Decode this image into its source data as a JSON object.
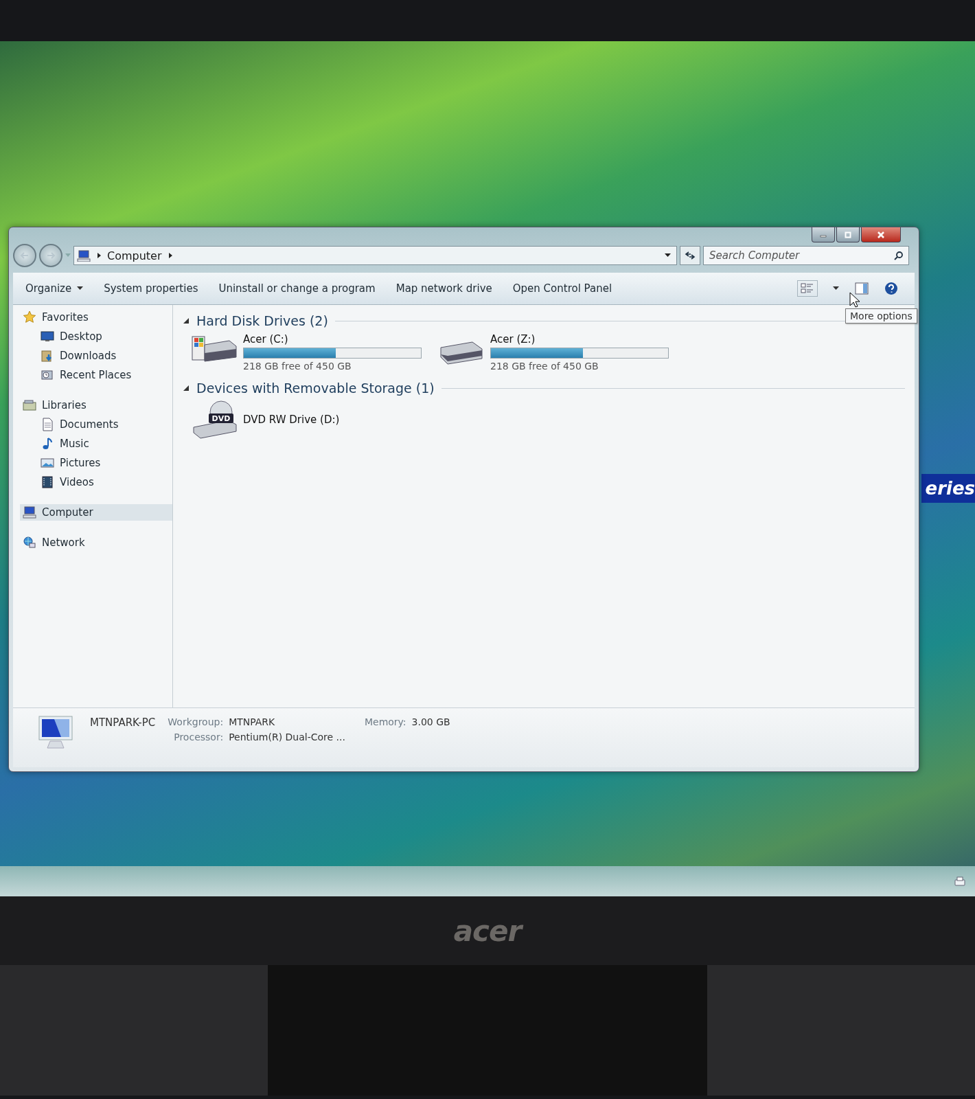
{
  "desktop": {
    "partial_text": "eries"
  },
  "window": {
    "address": {
      "breadcrumb": [
        "Computer"
      ]
    },
    "search": {
      "placeholder": "Search Computer"
    },
    "toolbar": [
      {
        "label": "Organize",
        "has_menu": true
      },
      {
        "label": "System properties",
        "has_menu": false
      },
      {
        "label": "Uninstall or change a program",
        "has_menu": false
      },
      {
        "label": "Map network drive",
        "has_menu": false
      },
      {
        "label": "Open Control Panel",
        "has_menu": false
      }
    ],
    "tooltip": "More options",
    "sidebar": [
      {
        "label": "Favorites",
        "kind": "favorites",
        "selected": false,
        "children": [
          {
            "label": "Desktop",
            "kind": "desktop",
            "selected": false
          },
          {
            "label": "Downloads",
            "kind": "downloads",
            "selected": false
          },
          {
            "label": "Recent Places",
            "kind": "recent",
            "selected": false
          }
        ]
      },
      {
        "label": "Libraries",
        "kind": "libraries",
        "selected": false,
        "children": [
          {
            "label": "Documents",
            "kind": "documents",
            "selected": false
          },
          {
            "label": "Music",
            "kind": "music",
            "selected": false
          },
          {
            "label": "Pictures",
            "kind": "pictures",
            "selected": false
          },
          {
            "label": "Videos",
            "kind": "videos",
            "selected": false
          }
        ]
      },
      {
        "label": "Computer",
        "kind": "computer",
        "selected": true
      },
      {
        "label": "Network",
        "kind": "network",
        "selected": false
      }
    ],
    "sections": [
      {
        "title": "Hard Disk Drives (2)",
        "expanded": true,
        "items": [
          {
            "kind": "system-disk",
            "name": "Acer (C:)",
            "level": 0.52,
            "space": "218 GB free of 450 GB"
          },
          {
            "kind": "disk",
            "name": "Acer (Z:)",
            "level": 0.52,
            "space": "218 GB free of 450 GB"
          }
        ]
      },
      {
        "title": "Devices with Removable Storage (1)",
        "expanded": true,
        "items": [
          {
            "kind": "dvd",
            "name": "DVD RW Drive (D:)",
            "icon_text": "DVD"
          }
        ]
      }
    ],
    "details": {
      "computer_name": "MTNPARK-PC",
      "fields": [
        {
          "label": "Workgroup:",
          "value": "MTNPARK"
        },
        {
          "label": "Memory:",
          "value": "3.00 GB"
        },
        {
          "label": "Processor:",
          "value": "Pentium(R) Dual-Core  ..."
        }
      ]
    }
  },
  "monitor": {
    "brand": "acer"
  }
}
